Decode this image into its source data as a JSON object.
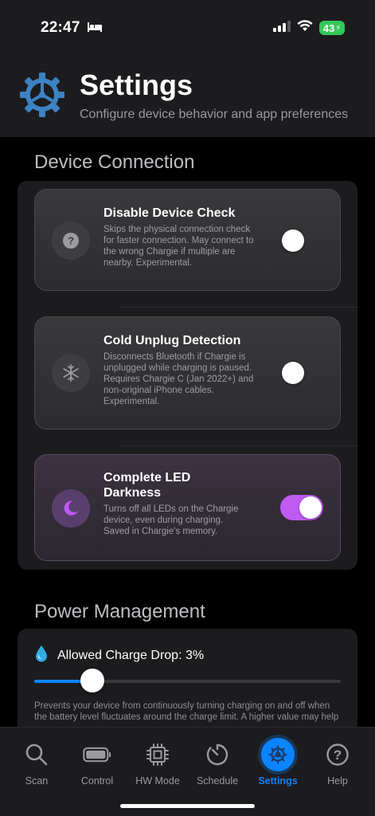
{
  "status": {
    "time": "22:47",
    "battery": "43"
  },
  "header": {
    "title": "Settings",
    "subtitle": "Configure device behavior and app preferences"
  },
  "device_connection": {
    "title": "Device Connection",
    "items": [
      {
        "title": "Disable Device Check",
        "description": "Skips the physical connection check for faster connection. May connect to the wrong Chargie if multiple are nearby. Experimental.",
        "icon": "question-icon",
        "enabled": false
      },
      {
        "title": "Cold Unplug Detection",
        "description": "Disconnects Bluetooth if Chargie is unplugged while charging is paused. Requires Chargie C (Jan 2022+) and non-original iPhone cables. Experimental.",
        "icon": "snowflake-icon",
        "enabled": false
      },
      {
        "title": "Complete LED Darkness",
        "description": "Turns off all LEDs on the Chargie device, even during charging. Saved in Chargie's memory.",
        "icon": "moon-icon",
        "enabled": true
      }
    ]
  },
  "power_management": {
    "title": "Power Management",
    "charge_drop_label": "Allowed Charge Drop: 3%",
    "charge_drop_percent": 3,
    "slider_fraction": 0.17,
    "description": "Prevents your device from continuously turning charging on and off when the battery level fluctuates around the charge limit. A higher value may help"
  },
  "tabs": [
    {
      "label": "Scan",
      "icon": "magnifier-icon",
      "active": false
    },
    {
      "label": "Control",
      "icon": "battery-icon",
      "active": false
    },
    {
      "label": "HW Mode",
      "icon": "chip-icon",
      "active": false
    },
    {
      "label": "Schedule",
      "icon": "timer-icon",
      "active": false
    },
    {
      "label": "Settings",
      "icon": "gear-icon",
      "active": true
    },
    {
      "label": "Help",
      "icon": "help-icon",
      "active": false
    }
  ],
  "colors": {
    "accent": "#0a84ff",
    "toggle_on": "#bf5af2",
    "battery": "#34c759"
  }
}
